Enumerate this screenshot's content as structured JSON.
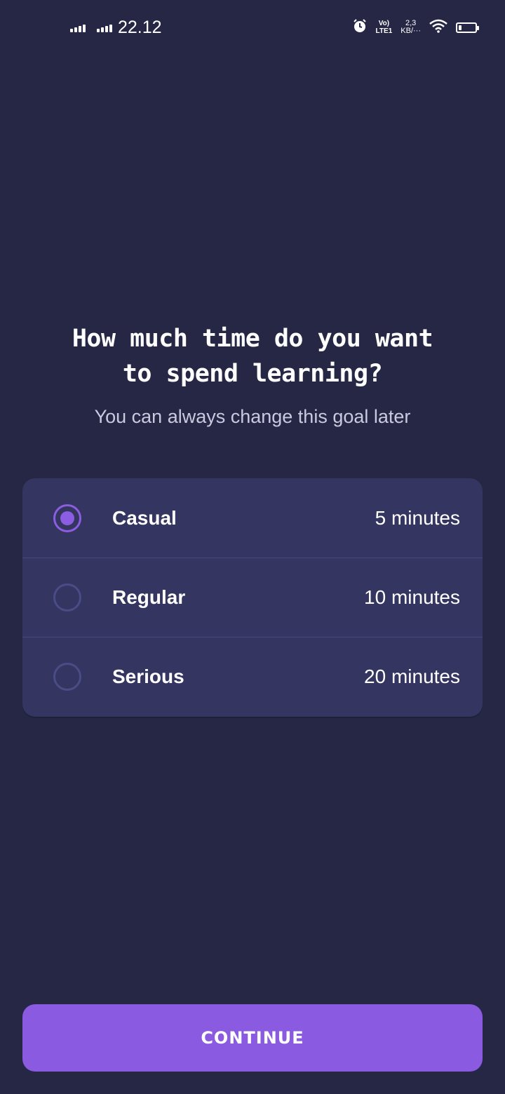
{
  "status_bar": {
    "time": "22.12",
    "volte_top": "Vo)",
    "volte_bottom": "LTE1",
    "speed_value": "2,3",
    "speed_unit": "KB/···",
    "icons": [
      "signal-icon",
      "signal-icon",
      "alarm-icon",
      "volte-icon",
      "wifi-icon",
      "battery-icon"
    ]
  },
  "heading": {
    "line1": "How much time do you want",
    "line2": "to spend learning?"
  },
  "subheading": "You can always change this goal later",
  "options": [
    {
      "label": "Casual",
      "value": "5 minutes",
      "selected": true
    },
    {
      "label": "Regular",
      "value": "10 minutes",
      "selected": false
    },
    {
      "label": "Serious",
      "value": "20 minutes",
      "selected": false
    }
  ],
  "continue_label": "CONTINUE",
  "colors": {
    "background": "#252744",
    "card": "#343560",
    "accent": "#8a5ae0",
    "radio_unselected": "#4a4c86"
  }
}
